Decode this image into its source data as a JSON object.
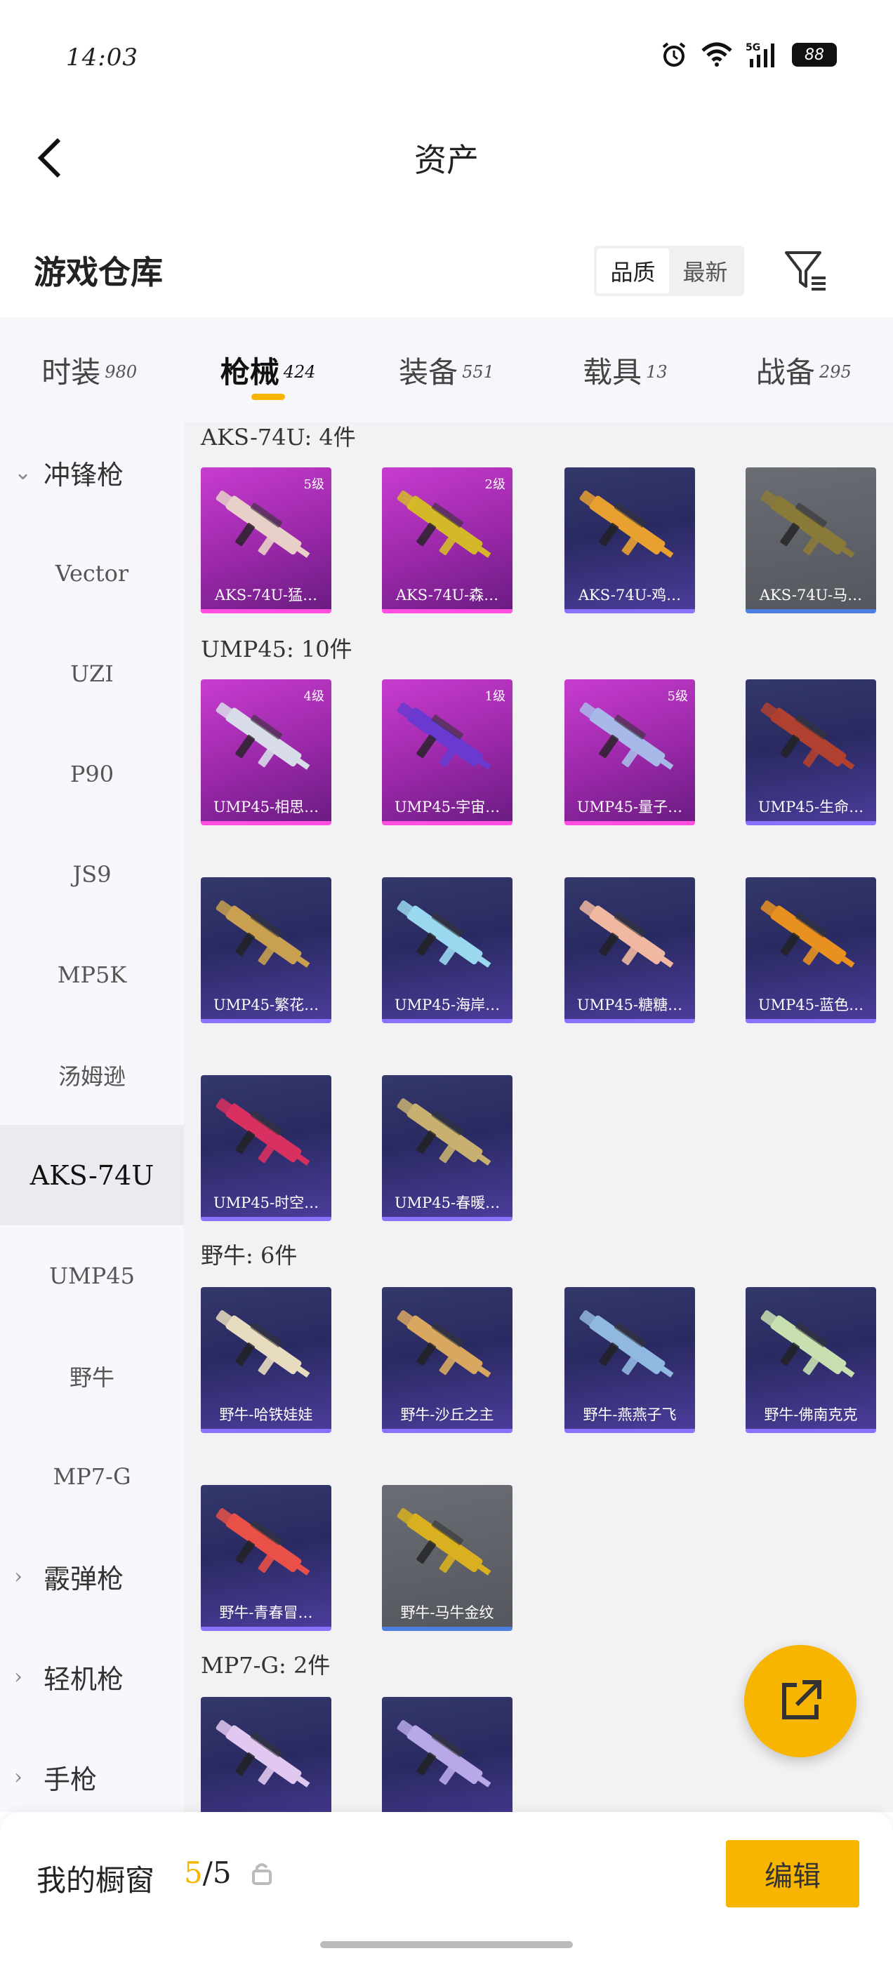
{
  "status": {
    "time": "14:03",
    "network": "5G",
    "battery": "88"
  },
  "header": {
    "title": "资产"
  },
  "warehouse": {
    "title": "游戏仓库",
    "sort_options": [
      "品质",
      "最新"
    ],
    "active_sort": 0
  },
  "tabs": [
    {
      "label": "时装",
      "count": "980"
    },
    {
      "label": "枪械",
      "count": "424"
    },
    {
      "label": "装备",
      "count": "551"
    },
    {
      "label": "载具",
      "count": "13"
    },
    {
      "label": "战备",
      "count": "295"
    }
  ],
  "sidebar": {
    "group_open": "冲锋枪",
    "items": [
      "Vector",
      "UZI",
      "P90",
      "JS9",
      "MP5K",
      "汤姆逊",
      "AKS-74U",
      "UMP45",
      "野牛",
      "MP7-G"
    ],
    "groups_closed": [
      "霰弹枪",
      "轻机枪",
      "手枪"
    ]
  },
  "sections": [
    {
      "title": "AKS-74U: 4件",
      "cards": [
        {
          "name": "AKS-74U-猛…",
          "level": "5级",
          "tier": "purple",
          "color": "#e8d0c8"
        },
        {
          "name": "AKS-74U-森…",
          "level": "2级",
          "tier": "purple",
          "color": "#d4b82a"
        },
        {
          "name": "AKS-74U-鸡…",
          "level": "",
          "tier": "blue",
          "color": "#e8a030"
        },
        {
          "name": "AKS-74U-马…",
          "level": "",
          "tier": "gray",
          "color": "#8a7a3a"
        }
      ]
    },
    {
      "title": "UMP45: 10件",
      "cards": [
        {
          "name": "UMP45-相思…",
          "level": "4级",
          "tier": "purple",
          "color": "#d8dce8"
        },
        {
          "name": "UMP45-宇宙…",
          "level": "1级",
          "tier": "purple",
          "color": "#6a3ad0"
        },
        {
          "name": "UMP45-量子…",
          "level": "5级",
          "tier": "purple",
          "color": "#a8b8e8"
        },
        {
          "name": "UMP45-生命…",
          "level": "",
          "tier": "blue",
          "color": "#b04030"
        },
        {
          "name": "UMP45-繁花…",
          "level": "",
          "tier": "blue",
          "color": "#c8a050"
        },
        {
          "name": "UMP45-海岸…",
          "level": "",
          "tier": "blue",
          "color": "#9ad8f0"
        },
        {
          "name": "UMP45-糖糖…",
          "level": "",
          "tier": "blue",
          "color": "#f0b8a0"
        },
        {
          "name": "UMP45-蓝色…",
          "level": "",
          "tier": "blue",
          "color": "#e89020"
        },
        {
          "name": "UMP45-时空…",
          "level": "",
          "tier": "blue",
          "color": "#d83060"
        },
        {
          "name": "UMP45-春暖…",
          "level": "",
          "tier": "blue",
          "color": "#c8b070"
        }
      ]
    },
    {
      "title": "野牛: 6件",
      "cards": [
        {
          "name": "野牛-哈铁娃娃",
          "level": "",
          "tier": "blue",
          "color": "#e8dcc0"
        },
        {
          "name": "野牛-沙丘之主",
          "level": "",
          "tier": "blue",
          "color": "#d8a860"
        },
        {
          "name": "野牛-燕燕子飞",
          "level": "",
          "tier": "blue",
          "color": "#90b8e0"
        },
        {
          "name": "野牛-佛南克克",
          "level": "",
          "tier": "blue",
          "color": "#c8e0b0"
        },
        {
          "name": "野牛-青春冒…",
          "level": "",
          "tier": "blue",
          "color": "#e85048"
        },
        {
          "name": "野牛-马牛金纹",
          "level": "",
          "tier": "gray",
          "color": "#d8b020"
        }
      ]
    },
    {
      "title": "MP7-G: 2件",
      "cards": [
        {
          "name": "",
          "level": "",
          "tier": "blue",
          "color": "#e0c8f0"
        },
        {
          "name": "",
          "level": "",
          "tier": "blue",
          "color": "#b8a8e8"
        }
      ]
    }
  ],
  "bottom": {
    "label": "我的橱窗",
    "count_current": "5",
    "count_total": "/5",
    "edit_label": "编辑"
  },
  "colors": {
    "accent": "#f7b500"
  }
}
